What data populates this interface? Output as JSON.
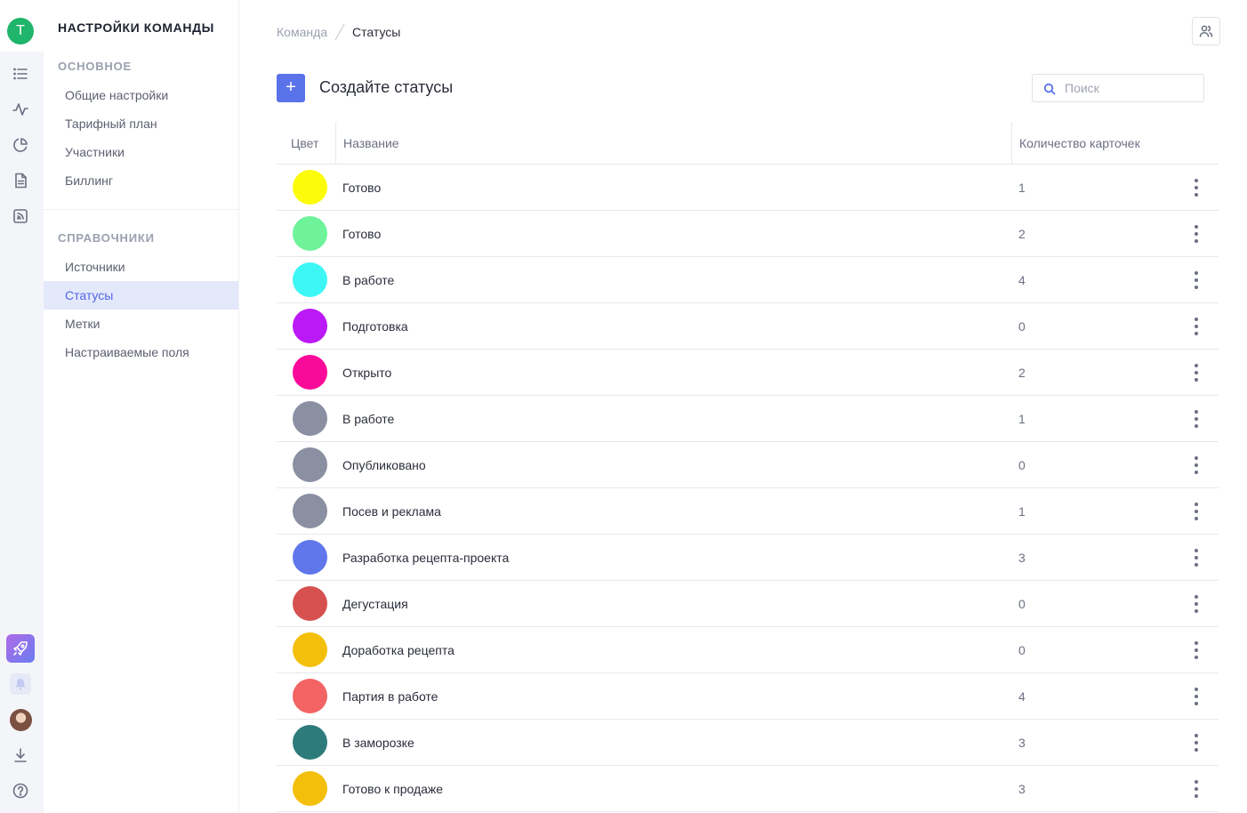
{
  "rail": {
    "team_initial": "T",
    "icons": [
      "list-icon",
      "activity-icon",
      "pie-chart-icon",
      "document-icon",
      "rss-icon",
      "rocket-icon",
      "bell-icon",
      "download-icon",
      "help-icon"
    ]
  },
  "sidebar": {
    "title": "НАСТРОЙКИ КОМАНДЫ",
    "sections": [
      {
        "title": "ОСНОВНОЕ",
        "items": [
          "Общие настройки",
          "Тарифный план",
          "Участники",
          "Биллинг"
        ]
      },
      {
        "title": "СПРАВОЧНИКИ",
        "items": [
          "Источники",
          "Статусы",
          "Метки",
          "Настраиваемые поля"
        ]
      }
    ],
    "active_item": "Статусы"
  },
  "breadcrumb": {
    "parent": "Команда",
    "current": "Статусы"
  },
  "toolbar": {
    "add_label": "+",
    "title": "Создайте статусы",
    "search_placeholder": "Поиск"
  },
  "table": {
    "headers": {
      "color": "Цвет",
      "name": "Название",
      "count": "Количество карточек"
    },
    "rows": [
      {
        "color": "#fcfc0a",
        "name": "Готово",
        "count": "1"
      },
      {
        "color": "#6ef29a",
        "name": "Готово",
        "count": "2"
      },
      {
        "color": "#3df6f6",
        "name": "В работе",
        "count": "4"
      },
      {
        "color": "#bb19f5",
        "name": "Подготовка",
        "count": "0"
      },
      {
        "color": "#fa0a98",
        "name": "Открыто",
        "count": "2"
      },
      {
        "color": "#8b8fa2",
        "name": "В работе",
        "count": "1"
      },
      {
        "color": "#8b8fa2",
        "name": "Опубликовано",
        "count": "0"
      },
      {
        "color": "#8b8fa2",
        "name": "Посев и реклама",
        "count": "1"
      },
      {
        "color": "#5f77ea",
        "name": "Разработка рецепта-проекта",
        "count": "3"
      },
      {
        "color": "#d65050",
        "name": "Дегустация",
        "count": "0"
      },
      {
        "color": "#f3bf0a",
        "name": "Доработка рецепта",
        "count": "0"
      },
      {
        "color": "#f36464",
        "name": "Партия в работе",
        "count": "4"
      },
      {
        "color": "#2e7b7b",
        "name": "В заморозке",
        "count": "3"
      },
      {
        "color": "#f3bf0a",
        "name": "Готово к продаже",
        "count": "3"
      }
    ]
  }
}
